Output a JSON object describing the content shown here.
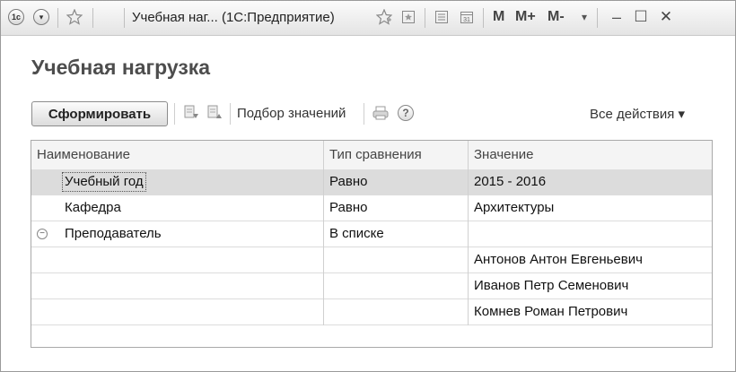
{
  "window": {
    "title": "Учебная наг...  (1С:Предприятие)",
    "m_label": "M",
    "mplus_label": "M+",
    "mminus_label": "M-",
    "minimize": "–",
    "maximize": "☐",
    "close": "✕"
  },
  "form": {
    "title": "Учебная нагрузка"
  },
  "toolbar": {
    "generate_label": "Сформировать",
    "pick_values_label": "Подбор значений",
    "all_actions_label": "Все действия ▾"
  },
  "table": {
    "columns": [
      "Наименование",
      "Тип сравнения",
      "Значение"
    ],
    "rows": [
      {
        "name": "Учебный год",
        "comparison": "Равно",
        "value": "2015 - 2016"
      },
      {
        "name": "Кафедра",
        "comparison": "Равно",
        "value": "Архитектуры"
      },
      {
        "name": "Преподаватель",
        "comparison": "В списке",
        "value": ""
      },
      {
        "name": "",
        "comparison": "",
        "value": "Антонов Антон Евгеньевич"
      },
      {
        "name": "",
        "comparison": "",
        "value": "Иванов Петр Семенович"
      },
      {
        "name": "",
        "comparison": "",
        "value": "Комнев Роман Петрович"
      }
    ]
  }
}
